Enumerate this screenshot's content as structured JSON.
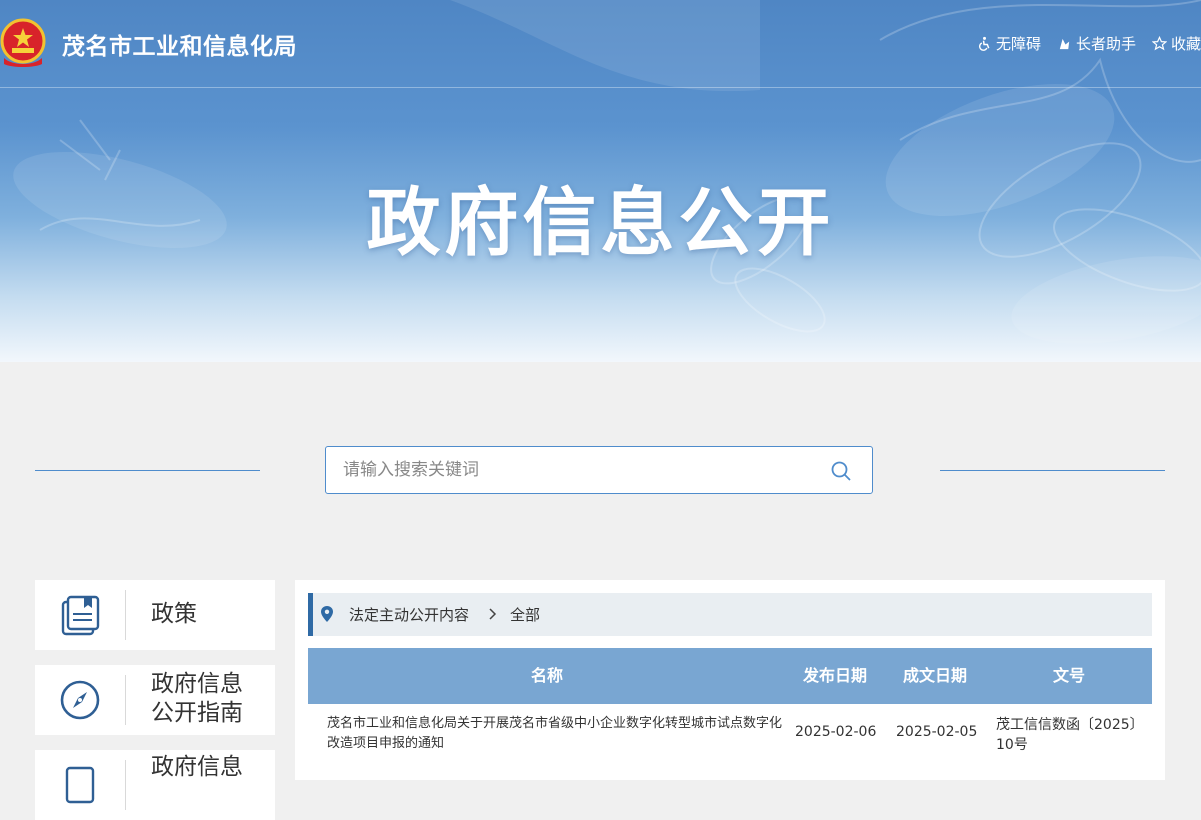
{
  "header": {
    "site_title": "茂名市工业和信息化局",
    "tools": [
      {
        "icon": "wheelchair-icon",
        "label": "无障碍"
      },
      {
        "icon": "elder-helper-icon",
        "label": "长者助手"
      },
      {
        "icon": "star-icon",
        "label": "收藏"
      }
    ]
  },
  "banner": {
    "title": "政府信息公开"
  },
  "search": {
    "placeholder": "请输入搜索关键词",
    "icon": "search-icon"
  },
  "sidebar": {
    "items": [
      {
        "icon": "book-icon",
        "label": "政策"
      },
      {
        "icon": "compass-icon",
        "label": "政府信息公开指南"
      },
      {
        "icon": "document-icon",
        "label": "政府信息"
      }
    ]
  },
  "breadcrumb": {
    "icon": "location-pin-icon",
    "parent": "法定主动公开内容",
    "current": "全部"
  },
  "table": {
    "headers": {
      "name": "名称",
      "publish_date": "发布日期",
      "created_date": "成文日期",
      "doc_no": "文号"
    },
    "rows": [
      {
        "name": "茂名市工业和信息化局关于开展茂名市省级中小企业数字化转型城市试点数字化改造项目申报的通知",
        "publish_date": "2025-02-06",
        "created_date": "2025-02-05",
        "doc_no": "茂工信信数函〔2025〕10号"
      }
    ]
  },
  "colors": {
    "accent": "#2f6aa5",
    "table_header": "#79a6d2",
    "banner_blue": "#5b93cf"
  }
}
